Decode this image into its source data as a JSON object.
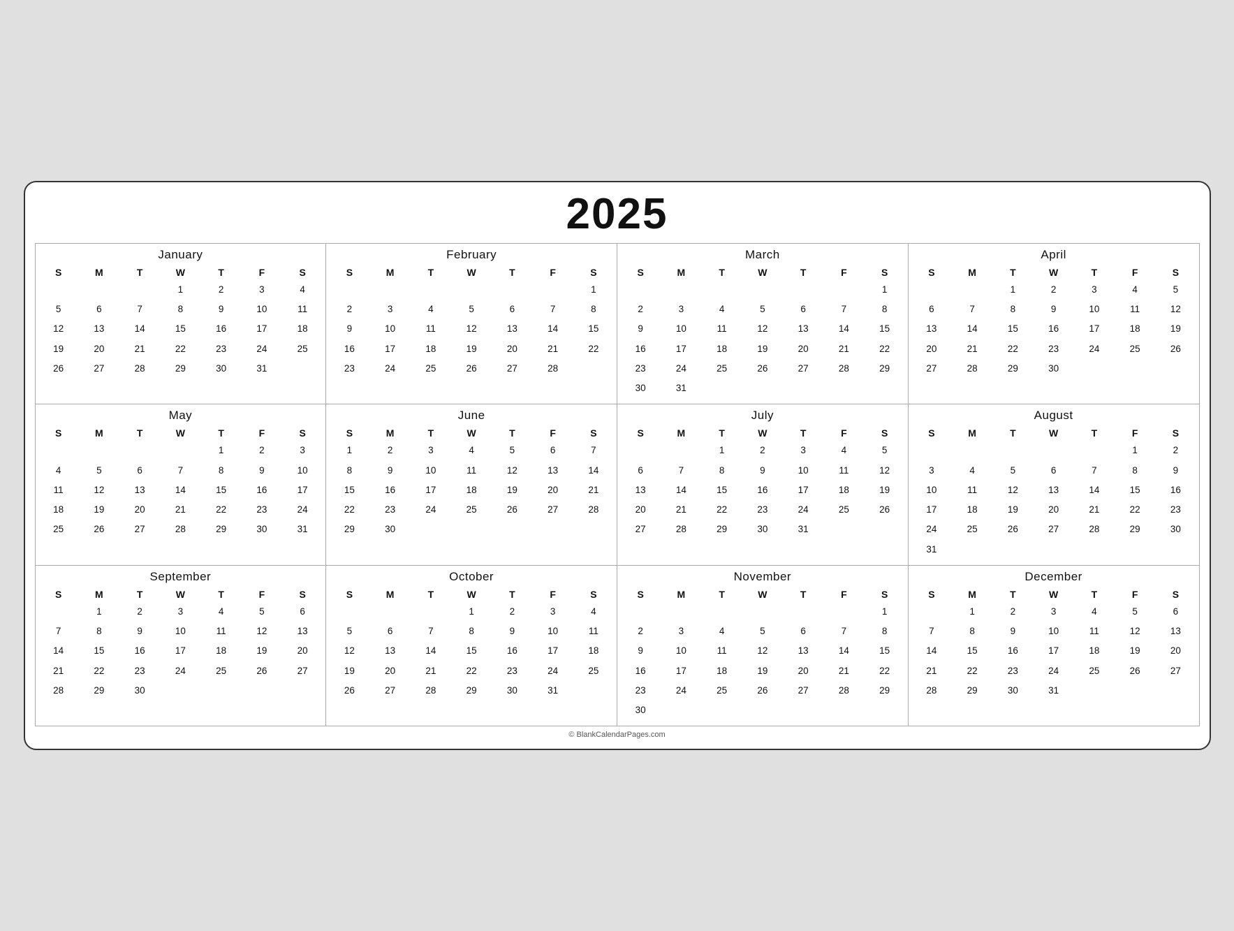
{
  "year": "2025",
  "footer": "© BlankCalendarPages.com",
  "days_header": [
    "S",
    "M",
    "T",
    "W",
    "T",
    "F",
    "S"
  ],
  "months": [
    {
      "name": "January",
      "weeks": [
        [
          "",
          "",
          "",
          "1",
          "2",
          "3",
          "4"
        ],
        [
          "5",
          "6",
          "7",
          "8",
          "9",
          "10",
          "11"
        ],
        [
          "12",
          "13",
          "14",
          "15",
          "16",
          "17",
          "18"
        ],
        [
          "19",
          "20",
          "21",
          "22",
          "23",
          "24",
          "25"
        ],
        [
          "26",
          "27",
          "28",
          "29",
          "30",
          "31",
          ""
        ]
      ]
    },
    {
      "name": "February",
      "weeks": [
        [
          "",
          "",
          "",
          "",
          "",
          "",
          "1"
        ],
        [
          "2",
          "3",
          "4",
          "5",
          "6",
          "7",
          "8"
        ],
        [
          "9",
          "10",
          "11",
          "12",
          "13",
          "14",
          "15"
        ],
        [
          "16",
          "17",
          "18",
          "19",
          "20",
          "21",
          "22"
        ],
        [
          "23",
          "24",
          "25",
          "26",
          "27",
          "28",
          ""
        ]
      ]
    },
    {
      "name": "March",
      "weeks": [
        [
          "",
          "",
          "",
          "",
          "",
          "",
          "1"
        ],
        [
          "2",
          "3",
          "4",
          "5",
          "6",
          "7",
          "8"
        ],
        [
          "9",
          "10",
          "11",
          "12",
          "13",
          "14",
          "15"
        ],
        [
          "16",
          "17",
          "18",
          "19",
          "20",
          "21",
          "22"
        ],
        [
          "23",
          "24",
          "25",
          "26",
          "27",
          "28",
          "29"
        ],
        [
          "30",
          "31",
          "",
          "",
          "",
          "",
          ""
        ]
      ]
    },
    {
      "name": "April",
      "weeks": [
        [
          "",
          "",
          "1",
          "2",
          "3",
          "4",
          "5"
        ],
        [
          "6",
          "7",
          "8",
          "9",
          "10",
          "11",
          "12"
        ],
        [
          "13",
          "14",
          "15",
          "16",
          "17",
          "18",
          "19"
        ],
        [
          "20",
          "21",
          "22",
          "23",
          "24",
          "25",
          "26"
        ],
        [
          "27",
          "28",
          "29",
          "30",
          "",
          "",
          ""
        ]
      ]
    },
    {
      "name": "May",
      "weeks": [
        [
          "",
          "",
          "",
          "",
          "1",
          "2",
          "3"
        ],
        [
          "4",
          "5",
          "6",
          "7",
          "8",
          "9",
          "10"
        ],
        [
          "11",
          "12",
          "13",
          "14",
          "15",
          "16",
          "17"
        ],
        [
          "18",
          "19",
          "20",
          "21",
          "22",
          "23",
          "24"
        ],
        [
          "25",
          "26",
          "27",
          "28",
          "29",
          "30",
          "31"
        ]
      ]
    },
    {
      "name": "June",
      "weeks": [
        [
          "1",
          "2",
          "3",
          "4",
          "5",
          "6",
          "7"
        ],
        [
          "8",
          "9",
          "10",
          "11",
          "12",
          "13",
          "14"
        ],
        [
          "15",
          "16",
          "17",
          "18",
          "19",
          "20",
          "21"
        ],
        [
          "22",
          "23",
          "24",
          "25",
          "26",
          "27",
          "28"
        ],
        [
          "29",
          "30",
          "",
          "",
          "",
          "",
          ""
        ]
      ]
    },
    {
      "name": "July",
      "weeks": [
        [
          "",
          "",
          "1",
          "2",
          "3",
          "4",
          "5"
        ],
        [
          "6",
          "7",
          "8",
          "9",
          "10",
          "11",
          "12"
        ],
        [
          "13",
          "14",
          "15",
          "16",
          "17",
          "18",
          "19"
        ],
        [
          "20",
          "21",
          "22",
          "23",
          "24",
          "25",
          "26"
        ],
        [
          "27",
          "28",
          "29",
          "30",
          "31",
          "",
          ""
        ]
      ]
    },
    {
      "name": "August",
      "weeks": [
        [
          "",
          "",
          "",
          "",
          "",
          "1",
          "2"
        ],
        [
          "3",
          "4",
          "5",
          "6",
          "7",
          "8",
          "9"
        ],
        [
          "10",
          "11",
          "12",
          "13",
          "14",
          "15",
          "16"
        ],
        [
          "17",
          "18",
          "19",
          "20",
          "21",
          "22",
          "23"
        ],
        [
          "24",
          "25",
          "26",
          "27",
          "28",
          "29",
          "30"
        ],
        [
          "31",
          "",
          "",
          "",
          "",
          "",
          ""
        ]
      ]
    },
    {
      "name": "September",
      "weeks": [
        [
          "",
          "1",
          "2",
          "3",
          "4",
          "5",
          "6"
        ],
        [
          "7",
          "8",
          "9",
          "10",
          "11",
          "12",
          "13"
        ],
        [
          "14",
          "15",
          "16",
          "17",
          "18",
          "19",
          "20"
        ],
        [
          "21",
          "22",
          "23",
          "24",
          "25",
          "26",
          "27"
        ],
        [
          "28",
          "29",
          "30",
          "",
          "",
          "",
          ""
        ]
      ]
    },
    {
      "name": "October",
      "weeks": [
        [
          "",
          "",
          "",
          "1",
          "2",
          "3",
          "4"
        ],
        [
          "5",
          "6",
          "7",
          "8",
          "9",
          "10",
          "11"
        ],
        [
          "12",
          "13",
          "14",
          "15",
          "16",
          "17",
          "18"
        ],
        [
          "19",
          "20",
          "21",
          "22",
          "23",
          "24",
          "25"
        ],
        [
          "26",
          "27",
          "28",
          "29",
          "30",
          "31",
          ""
        ]
      ]
    },
    {
      "name": "November",
      "weeks": [
        [
          "",
          "",
          "",
          "",
          "",
          "",
          "1"
        ],
        [
          "2",
          "3",
          "4",
          "5",
          "6",
          "7",
          "8"
        ],
        [
          "9",
          "10",
          "11",
          "12",
          "13",
          "14",
          "15"
        ],
        [
          "16",
          "17",
          "18",
          "19",
          "20",
          "21",
          "22"
        ],
        [
          "23",
          "24",
          "25",
          "26",
          "27",
          "28",
          "29"
        ],
        [
          "30",
          "",
          "",
          "",
          "",
          "",
          ""
        ]
      ]
    },
    {
      "name": "December",
      "weeks": [
        [
          "",
          "1",
          "2",
          "3",
          "4",
          "5",
          "6"
        ],
        [
          "7",
          "8",
          "9",
          "10",
          "11",
          "12",
          "13"
        ],
        [
          "14",
          "15",
          "16",
          "17",
          "18",
          "19",
          "20"
        ],
        [
          "21",
          "22",
          "23",
          "24",
          "25",
          "26",
          "27"
        ],
        [
          "28",
          "29",
          "30",
          "31",
          "",
          "",
          ""
        ]
      ]
    }
  ]
}
